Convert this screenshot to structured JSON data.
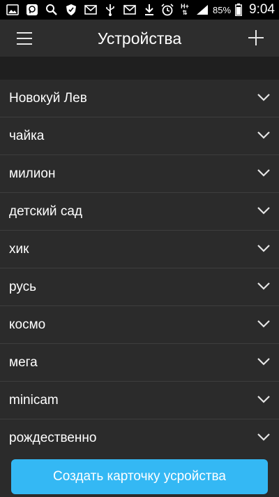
{
  "status_bar": {
    "left_icons": [
      "image-icon",
      "messenger-icon",
      "search-icon",
      "shield-icon",
      "mail-icon",
      "usb-icon",
      "mail-icon",
      "download-icon"
    ],
    "right_icons": [
      "alarm-icon",
      "network-hplus-icon",
      "signal-icon",
      "battery-icon"
    ],
    "network_label": "H+",
    "battery": "85%",
    "time": "9:04"
  },
  "header": {
    "title": "Устройства",
    "menu_icon": "hamburger-menu-icon",
    "add_icon": "plus-icon"
  },
  "devices": [
    {
      "name": "Новокуй Лев"
    },
    {
      "name": "чайка"
    },
    {
      "name": "милион"
    },
    {
      "name": "детский сад"
    },
    {
      "name": "хик"
    },
    {
      "name": "русь"
    },
    {
      "name": "космо"
    },
    {
      "name": "мега"
    },
    {
      "name": "minicam"
    },
    {
      "name": "рождественно"
    }
  ],
  "footer": {
    "create_button_label": "Создать карточку усройства"
  },
  "colors": {
    "accent": "#34b8f4",
    "background": "#2b2b2b",
    "status_bar": "#000000",
    "band": "#1f1f1f",
    "divider": "#3e3e3e"
  }
}
